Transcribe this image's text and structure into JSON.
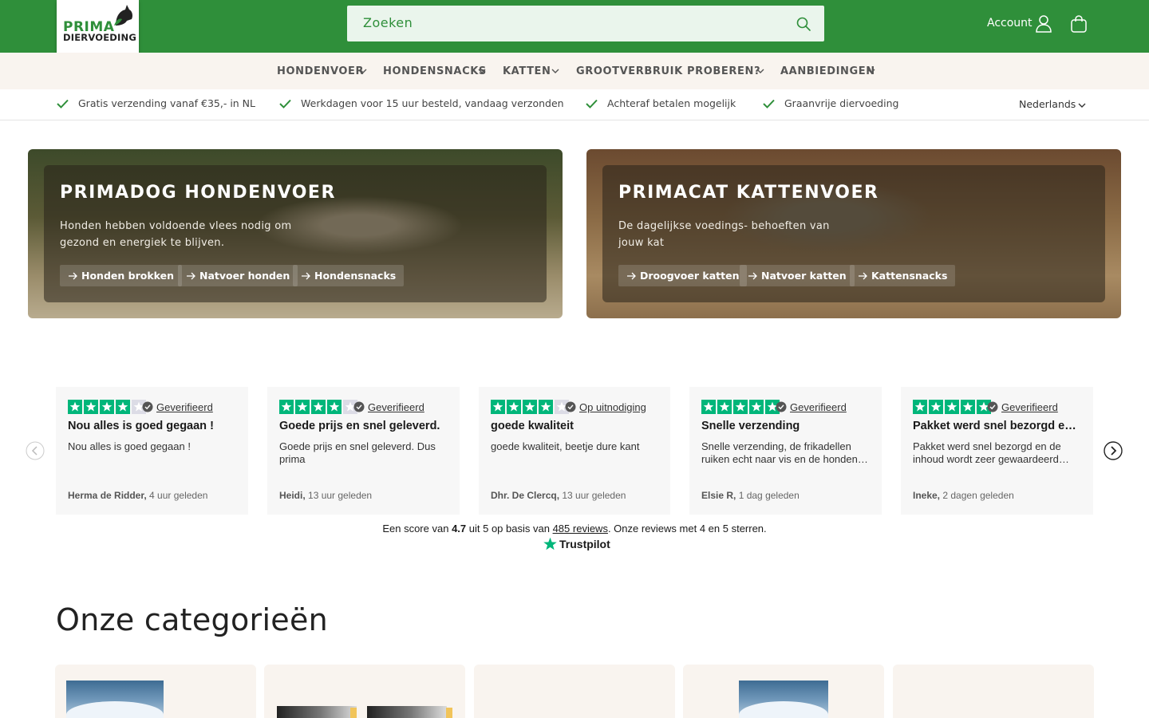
{
  "header": {
    "logo": {
      "line1": "PRIMA",
      "line2": "DIERVOEDING"
    },
    "search_placeholder": "Zoeken",
    "account_label": "Account"
  },
  "nav": {
    "items": [
      {
        "label": "HONDENVOER",
        "dropdown": true
      },
      {
        "label": "HONDENSNACKS",
        "dropdown": true
      },
      {
        "label": "KATTEN",
        "dropdown": true
      },
      {
        "label": "GROOTVERBRUIK",
        "dropdown": false
      },
      {
        "label": "PROBEREN?",
        "dropdown": true
      },
      {
        "label": "AANBIEDINGEN",
        "dropdown": true
      }
    ]
  },
  "usp": {
    "items": [
      "Gratis verzending vanaf €35,- in NL",
      "Werkdagen voor 15 uur besteld, vandaag verzonden",
      "Achteraf betalen mogelijk",
      "Graanvrije diervoeding"
    ],
    "language": "Nederlands"
  },
  "banners": [
    {
      "title": "PRIMADOG HONDENVOER",
      "text": "Honden hebben voldoende vlees nodig om gezond en energiek te blijven.",
      "buttons": [
        "Honden brokken",
        "Natvoer honden",
        "Hondensnacks"
      ]
    },
    {
      "title": "PRIMACAT KATTENVOER",
      "text": "De dagelijkse voedings- behoeften van jouw kat",
      "buttons": [
        "Droogvoer katten",
        "Natvoer katten",
        "Kattensnacks"
      ]
    }
  ],
  "reviews": [
    {
      "stars": 4,
      "badge": "Geverifieerd",
      "title": "Nou alles is goed gegaan !",
      "body": "Nou alles is goed gegaan !",
      "author": "Herma de Ridder,",
      "time": "4 uur geleden"
    },
    {
      "stars": 4,
      "badge": "Geverifieerd",
      "title": "Goede prijs en snel geleverd.",
      "body": "Goede prijs en snel geleverd. Dus prima",
      "author": "Heidi,",
      "time": "13 uur geleden"
    },
    {
      "stars": 4,
      "badge": "Op uitnodiging",
      "title": "goede kwaliteit",
      "body": "goede kwaliteit, beetje dure kant",
      "author": "Dhr. De Clercq,",
      "time": "13 uur geleden"
    },
    {
      "stars": 5,
      "badge": "Geverifieerd",
      "title": "Snelle verzending",
      "body": "Snelle verzending, de frikadellen ruiken echt naar vis en de honden zijn er gek op",
      "author": "Elsie R,",
      "time": "1 dag geleden"
    },
    {
      "stars": 5,
      "badge": "Geverifieerd",
      "title": "Pakket werd snel bezorgd en de inhoud",
      "body": "Pakket werd snel bezorgd en de inhoud wordt zeer gewaardeerd door de honden",
      "author": "Ineke,",
      "time": "2 dagen geleden"
    }
  ],
  "trustpilot": {
    "score_prefix": "Een score van",
    "score": "4.7",
    "score_mid": "uit 5 op basis van",
    "reviews_link": "485 reviews",
    "score_suffix": ". Onze reviews met 4 en 5 sterren.",
    "brand": "Trustpilot"
  },
  "categories": {
    "heading": "Onze categorieën"
  },
  "colors": {
    "brand_green": "#2f8f3a",
    "trustpilot_green": "#00b67a",
    "cream": "#f9f4ef"
  }
}
